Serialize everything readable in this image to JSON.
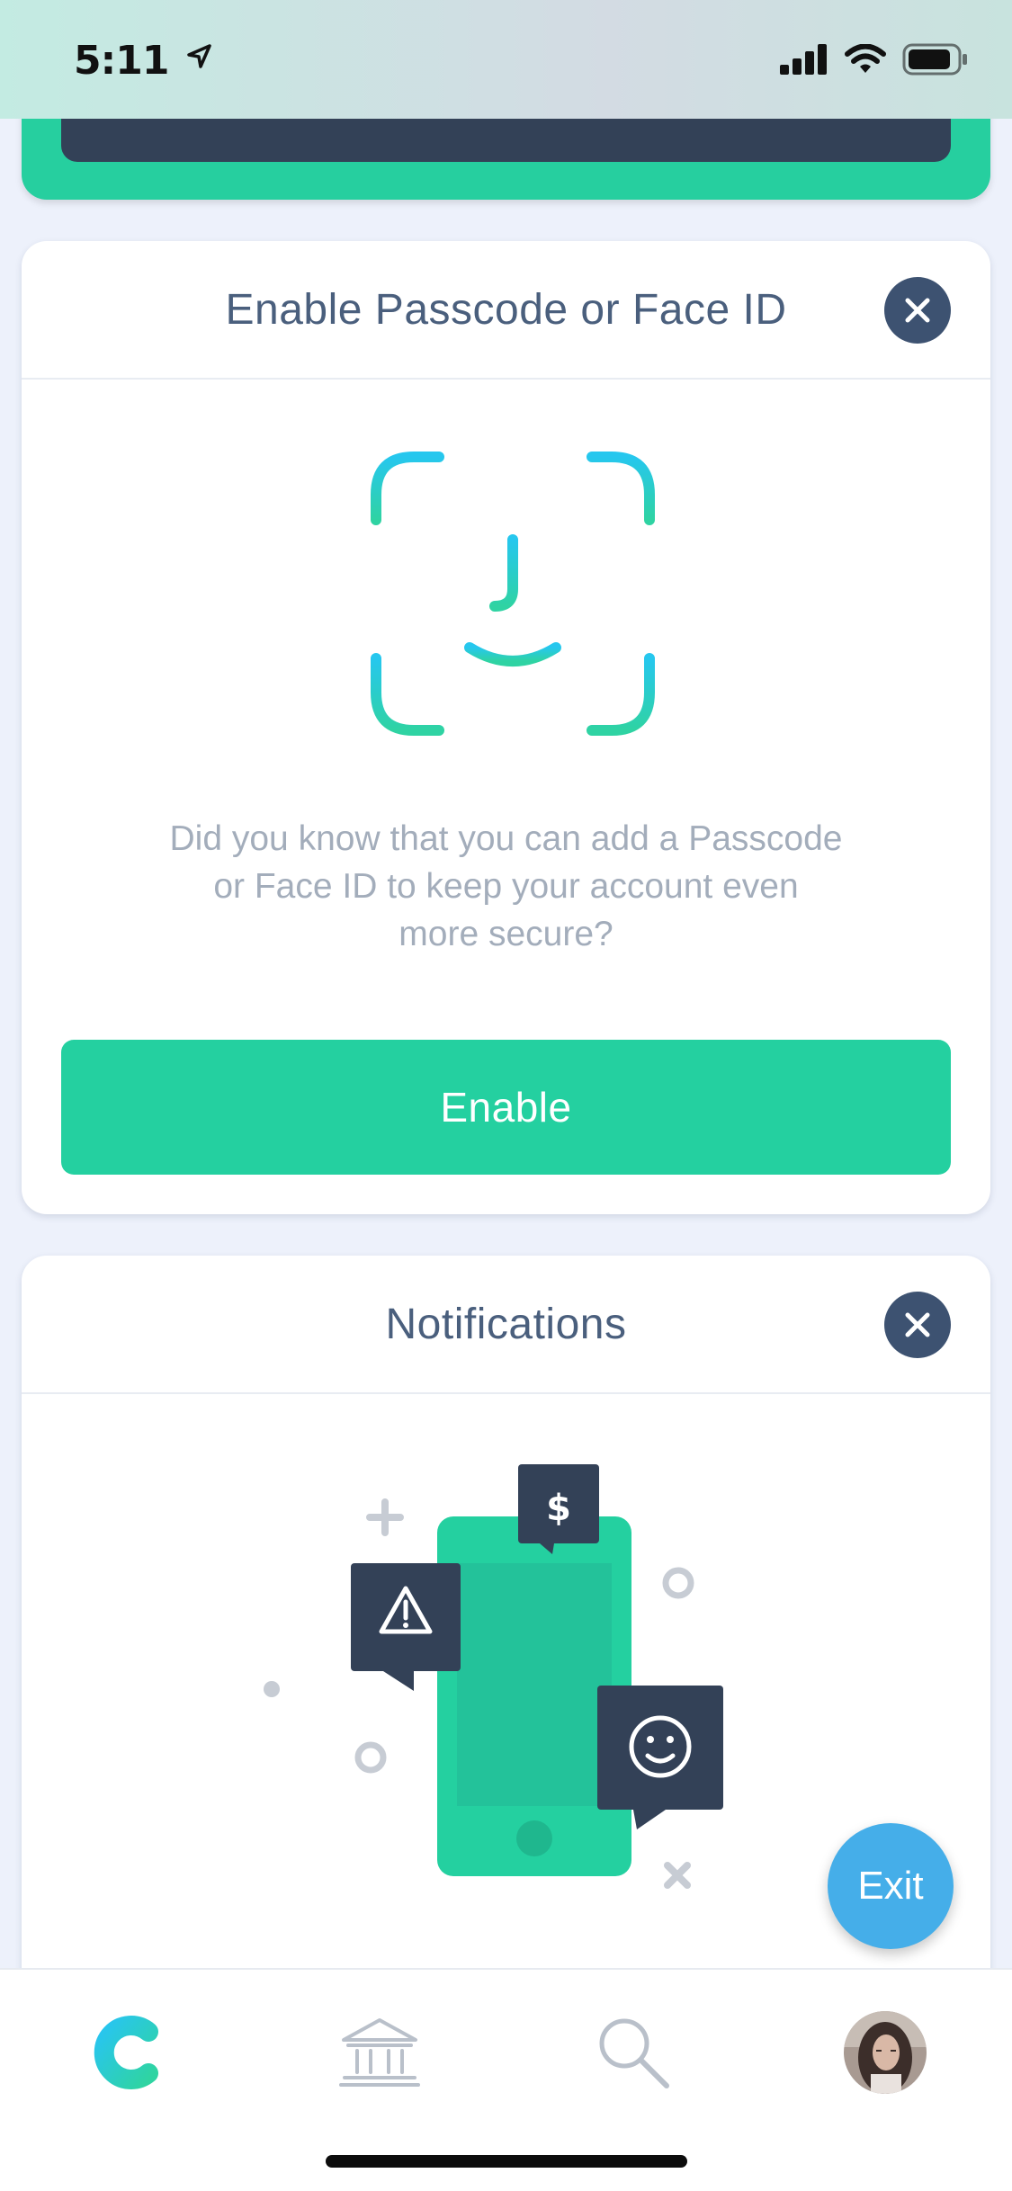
{
  "status_bar": {
    "time": "5:11",
    "icons": [
      "location-arrow-icon",
      "cellular-signal-icon",
      "wifi-icon",
      "battery-icon"
    ]
  },
  "passcode_card": {
    "title": "Enable Passcode or Face ID",
    "description_lines": [
      "Did you know that you can add a Passcode",
      "or Face ID to keep your account even",
      "more secure?"
    ],
    "button_label": "Enable",
    "illustration": "face-id-icon"
  },
  "notifications_card": {
    "title": "Notifications",
    "illustration": "phone-notifications-illustration",
    "bubble_dollar": "$"
  },
  "exit_button": {
    "label": "Exit"
  },
  "tab_bar": {
    "items": [
      {
        "name": "home",
        "icon": "brand-c-logo-icon",
        "active": true
      },
      {
        "name": "accounts",
        "icon": "bank-icon",
        "active": false
      },
      {
        "name": "search",
        "icon": "search-icon",
        "active": false
      },
      {
        "name": "profile",
        "icon": "avatar-icon",
        "active": false
      }
    ]
  },
  "colors": {
    "accent_green": "#24d0a0",
    "navy": "#334157",
    "title_text": "#4a5f7d",
    "muted_text": "#a3adbb",
    "exit_blue": "#45aee9",
    "background": "#edf1fb"
  }
}
